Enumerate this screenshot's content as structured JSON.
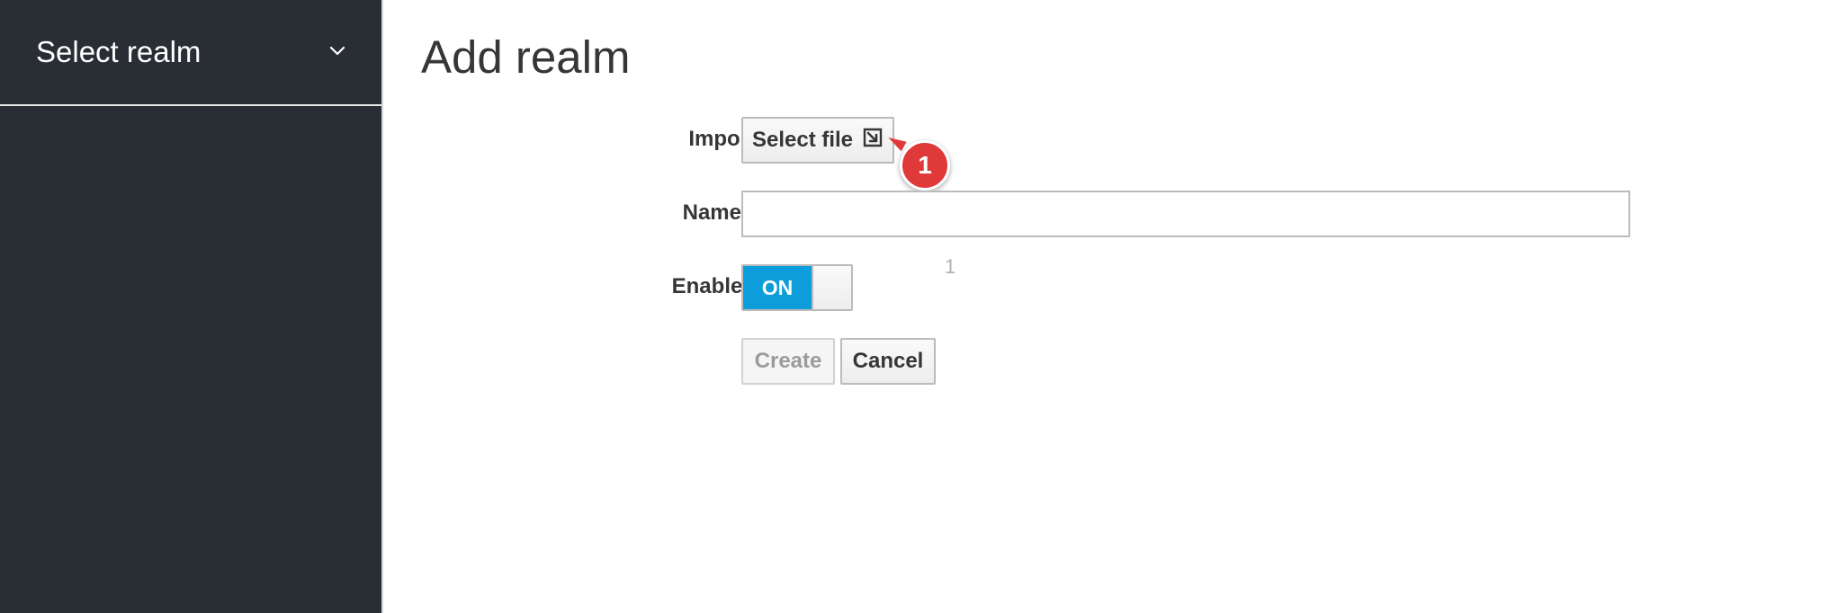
{
  "sidebar": {
    "realm_selector_label": "Select realm",
    "realm_selector_icon": "chevron-down-icon"
  },
  "main": {
    "page_title": "Add realm",
    "form": {
      "import_label": "Import",
      "select_file_label": "Select file",
      "select_file_icon": "external-import-icon",
      "name_label": "Name",
      "name_required_marker": "*",
      "name_value": "",
      "enabled_label": "Enabled",
      "enabled_toggle_text": "ON",
      "enabled_state": true,
      "create_label": "Create",
      "cancel_label": "Cancel"
    },
    "annotation": {
      "badge_number": "1",
      "stray_mark": "1"
    }
  },
  "colors": {
    "sidebar_bg": "#292e34",
    "toggle_on": "#0d9ddb",
    "required": "#cc0000",
    "annotation": "#e0393a"
  }
}
